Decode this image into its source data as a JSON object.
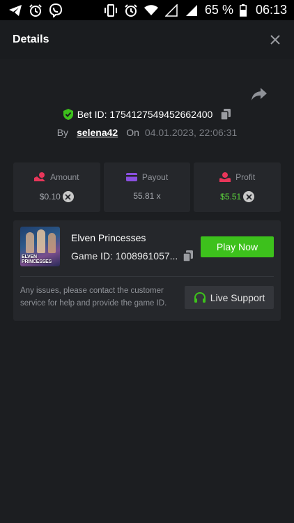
{
  "status_bar": {
    "left_icons": [
      "telegram-icon",
      "alarm-icon",
      "viber-icon"
    ],
    "right_icons": [
      "vibrate-icon",
      "alarm-icon",
      "wifi-icon",
      "signal-empty-icon",
      "signal-icon"
    ],
    "battery": "65 %",
    "time": "06:13"
  },
  "header": {
    "title": "Details",
    "close_icon": "close-icon"
  },
  "bet": {
    "id_label": "Bet ID: 1754127549452662400",
    "by_label": "By",
    "username": "selena42",
    "on_label": "On",
    "date": "04.01.2023, 22:06:31"
  },
  "stats": {
    "amount": {
      "label": "Amount",
      "value": "$0.10"
    },
    "payout": {
      "label": "Payout",
      "value": "55.81 x"
    },
    "profit": {
      "label": "Profit",
      "value": "$5.51"
    }
  },
  "game": {
    "name": "Elven Princesses",
    "thumb_text": "ELVEN PRINCESSES",
    "game_id": "Game ID: 1008961057...",
    "play_label": "Play Now",
    "issue_text": "Any issues, please contact the customer service for help and provide the game ID.",
    "support_label": "Live Support"
  },
  "colors": {
    "background": "#1c1e21",
    "panel": "#25272b",
    "accent_green": "#3dc11c",
    "profit_green": "#5bd13c",
    "amount_icon": "#e8365a",
    "payout_icon": "#8a4fe0",
    "profit_icon": "#e8365a"
  }
}
